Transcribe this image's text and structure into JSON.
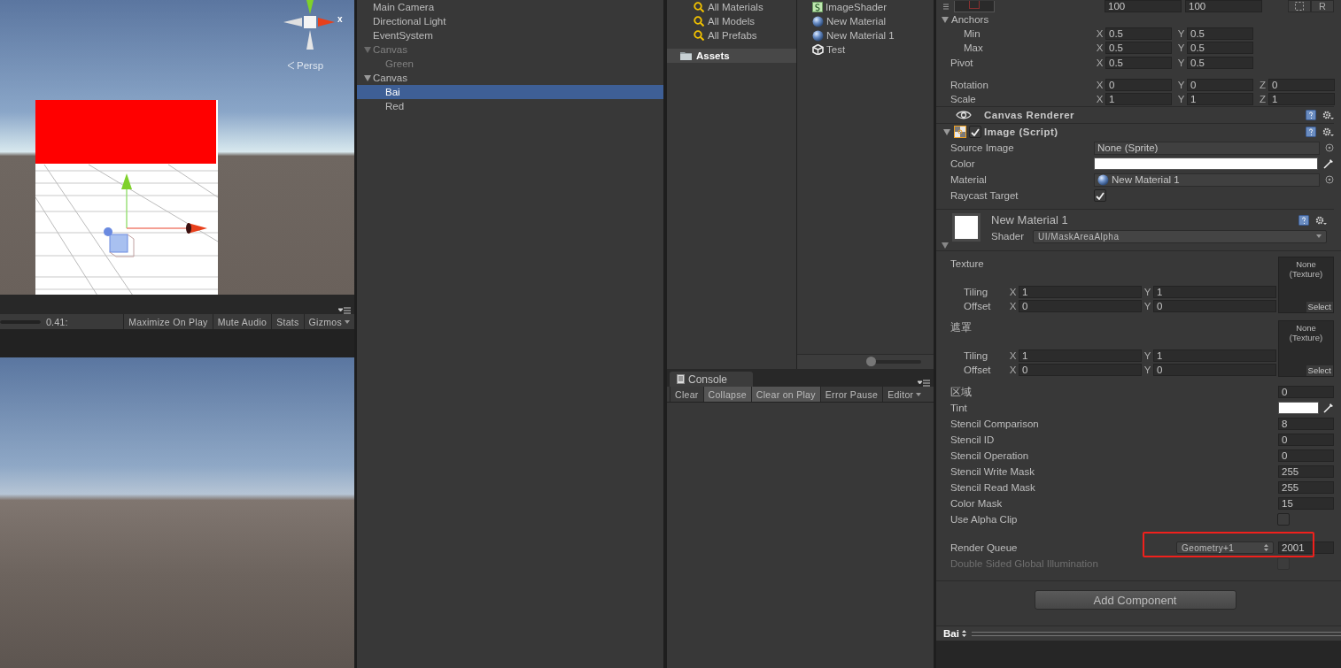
{
  "scene_view": {
    "gizmo_axis": "x",
    "projection": "Persp"
  },
  "game_toolbar": {
    "scale_slider": {
      "level": 1
    },
    "scale": "0.41:",
    "buttons": [
      {
        "label": "Maximize On Play",
        "pressed": false,
        "dropdown": false
      },
      {
        "label": "Mute Audio",
        "pressed": false,
        "dropdown": false
      },
      {
        "label": "Stats",
        "pressed": false,
        "dropdown": false
      },
      {
        "label": "Gizmos",
        "pressed": false,
        "dropdown": true
      }
    ]
  },
  "hierarchy": {
    "items": [
      {
        "label": "Main Camera",
        "selected": false,
        "disabled": false
      },
      {
        "label": "Directional Light",
        "selected": false,
        "disabled": false
      },
      {
        "label": "EventSystem",
        "selected": false,
        "disabled": false
      },
      {
        "label": "Canvas",
        "selected": false,
        "disabled": true,
        "expanded": true,
        "children": [
          {
            "label": "Green",
            "selected": false,
            "disabled": true
          }
        ]
      },
      {
        "label": "Canvas",
        "selected": false,
        "disabled": false,
        "expanded": true,
        "children": [
          {
            "label": "Bai",
            "selected": true,
            "disabled": false
          },
          {
            "label": "Red",
            "selected": false,
            "disabled": false
          }
        ]
      }
    ]
  },
  "project": {
    "favorites": [
      {
        "label": "All Materials"
      },
      {
        "label": "All Models"
      },
      {
        "label": "All Prefabs"
      }
    ],
    "folders": [
      {
        "label": "Assets",
        "selected": true
      }
    ],
    "assets": [
      {
        "name": "ImageShader",
        "kind": "shader"
      },
      {
        "name": "New Material",
        "kind": "material"
      },
      {
        "name": "New Material 1",
        "kind": "material"
      },
      {
        "name": "Test",
        "kind": "scene"
      }
    ]
  },
  "console": {
    "tab": "Console",
    "buttons": [
      {
        "label": "Clear",
        "pressed": false,
        "dropdown": false
      },
      {
        "label": "Collapse",
        "pressed": true,
        "dropdown": false
      },
      {
        "label": "Clear on Play",
        "pressed": true,
        "dropdown": false
      },
      {
        "label": "Error Pause",
        "pressed": false,
        "dropdown": false
      },
      {
        "label": "Editor",
        "pressed": false,
        "dropdown": true
      }
    ]
  },
  "inspector": {
    "size_fields": [
      "100",
      "100"
    ],
    "raw_button": "R",
    "anchors": {
      "label": "Anchors",
      "expanded": true,
      "children": [
        {
          "label": "Min",
          "fields": [
            {
              "axis": "X",
              "value": "0.5"
            },
            {
              "axis": "Y",
              "value": "0.5"
            }
          ]
        },
        {
          "label": "Max",
          "fields": [
            {
              "axis": "X",
              "value": "0.5"
            },
            {
              "axis": "Y",
              "value": "0.5"
            }
          ]
        }
      ]
    },
    "pivot": {
      "label": "Pivot",
      "fields": [
        {
          "axis": "X",
          "value": "0.5"
        },
        {
          "axis": "Y",
          "value": "0.5"
        }
      ]
    },
    "transform_rows": [
      {
        "label": "Rotation",
        "fields": [
          {
            "axis": "X",
            "value": "0"
          },
          {
            "axis": "Y",
            "value": "0"
          },
          {
            "axis": "Z",
            "value": "0"
          }
        ]
      },
      {
        "label": "Scale",
        "fields": [
          {
            "axis": "X",
            "value": "1"
          },
          {
            "axis": "Y",
            "value": "1"
          },
          {
            "axis": "Z",
            "value": "1"
          }
        ]
      }
    ],
    "components": [
      {
        "kind": "canvas_renderer",
        "title": "Canvas Renderer"
      },
      {
        "kind": "image",
        "title": "Image (Script)",
        "enabled": true,
        "expanded": true,
        "props": [
          {
            "kind": "object",
            "label": "Source Image",
            "value": "None (Sprite)",
            "icon": false
          },
          {
            "kind": "color",
            "label": "Color",
            "color": "#ffffff"
          },
          {
            "kind": "object",
            "label": "Material",
            "value": "New Material 1",
            "icon": true
          },
          {
            "kind": "checkbox",
            "label": "Raycast Target",
            "checked": true
          }
        ]
      }
    ],
    "material": {
      "name": "New Material 1",
      "shader_label": "Shader",
      "shader": "UI/MaskAreaAlpha",
      "textures": [
        {
          "label": "Texture",
          "thumb": "None (Texture)",
          "select": "Select",
          "rows": [
            {
              "label": "Tiling",
              "fields": [
                {
                  "axis": "X",
                  "value": "1"
                },
                {
                  "axis": "Y",
                  "value": "1"
                }
              ]
            },
            {
              "label": "Offset",
              "fields": [
                {
                  "axis": "X",
                  "value": "0"
                },
                {
                  "axis": "Y",
                  "value": "0"
                }
              ]
            }
          ]
        },
        {
          "label": "遮罩",
          "thumb": "None (Texture)",
          "select": "Select",
          "rows": [
            {
              "label": "Tiling",
              "fields": [
                {
                  "axis": "X",
                  "value": "1"
                },
                {
                  "axis": "Y",
                  "value": "1"
                }
              ]
            },
            {
              "label": "Offset",
              "fields": [
                {
                  "axis": "X",
                  "value": "0"
                },
                {
                  "axis": "Y",
                  "value": "0"
                }
              ]
            }
          ]
        }
      ],
      "props": [
        {
          "kind": "number",
          "label": "区域",
          "value": "0"
        },
        {
          "kind": "color",
          "label": "Tint",
          "color": "#ffffff"
        },
        {
          "kind": "number",
          "label": "Stencil Comparison",
          "value": "8"
        },
        {
          "kind": "number",
          "label": "Stencil ID",
          "value": "0"
        },
        {
          "kind": "number",
          "label": "Stencil Operation",
          "value": "0"
        },
        {
          "kind": "number",
          "label": "Stencil Write Mask",
          "value": "255"
        },
        {
          "kind": "number",
          "label": "Stencil Read Mask",
          "value": "255"
        },
        {
          "kind": "number",
          "label": "Color Mask",
          "value": "15"
        },
        {
          "kind": "checkbox",
          "label": "Use Alpha Clip",
          "checked": false,
          "disabled": false
        },
        {
          "kind": "queue",
          "label": "Render Queue",
          "option": "Geometry+1",
          "value": "2001",
          "highlighted": true
        },
        {
          "kind": "checkbox",
          "label": "Double Sided Global Illumination",
          "checked": false,
          "disabled": true
        }
      ]
    },
    "add_component": "Add Component"
  },
  "footer": {
    "selection": "Bai"
  }
}
